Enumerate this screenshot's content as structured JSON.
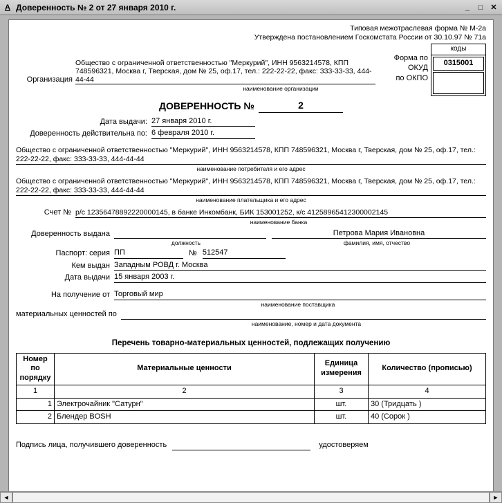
{
  "window": {
    "title": "Доверенность № 2 от 27 января 2010 г."
  },
  "hdr": {
    "form_line": "Типовая межотраслевая форма № М-2а",
    "approved_line": "Утверждена постановлением Госкомстата России от 30.10.97 № 71а",
    "okud_label": "Форма по ОКУД",
    "codes_label": "коды",
    "okud_code": "0315001",
    "okpo_label": "по ОКПО",
    "okpo_code": "",
    "org_label": "Организация",
    "org_text": "Общество с ограниченной ответственностью \"Меркурий\", ИНН 9563214578, КПП 748596321, Москва г, Тверская, дом № 25, оф.17, тел.: 222-22-22, факс: 333-33-33, 444-44-44",
    "org_caption": "наименование организации"
  },
  "doc": {
    "title": "ДОВЕРЕННОСТЬ  №",
    "number": "2",
    "issue_label": "Дата выдачи:",
    "issue_date": "27 января 2010 г.",
    "valid_label": "Доверенность действительна по:",
    "valid_date": "6 февраля 2010 г."
  },
  "consumer": {
    "text": "Общество с ограниченной ответственностью \"Меркурий\", ИНН 9563214578, КПП 748596321, Москва г, Тверская, дом № 25, оф.17, тел.: 222-22-22, факс: 333-33-33, 444-44-44",
    "caption": "наименование потребителя и его адрес"
  },
  "payer": {
    "text": "Общество с ограниченной ответственностью \"Меркурий\", ИНН 9563214578, КПП 748596321, Москва г, Тверская, дом № 25, оф.17, тел.: 222-22-22, факс: 333-33-33, 444-44-44",
    "caption": "наименование плательщика и его адрес"
  },
  "bank": {
    "account_label": "Счет №",
    "account_text": "р/с 12356478892220000145, в банке Инкомбанк, БИК 153001252, к/с 41258965412300002145",
    "caption": "наименование банка"
  },
  "person": {
    "issued_label": "Доверенность выдана",
    "position": "",
    "position_caption": "должность",
    "fio": "Петрова Мария Ивановна",
    "fio_caption": "фамилия, имя, отчество",
    "pass_label": "Паспорт: серия",
    "pass_series": "ПП",
    "pass_num_label": "№",
    "pass_num": "512547",
    "issued_by_label": "Кем выдан",
    "issued_by": "Западным РОВД г. Москва",
    "issue_date_label": "Дата выдачи",
    "issue_date": "15 января 2003 г."
  },
  "receive": {
    "from_label": "На получение от",
    "supplier": "Торговый мир",
    "supplier_caption": "наименование поставщика",
    "values_label": "материальных ценностей по",
    "doc_caption": "наименование, номер и дата документа"
  },
  "items_section": {
    "title": "Перечень товарно-материальных ценностей, подлежащих получению",
    "col1": "Номер по порядку",
    "col2": "Материальные ценности",
    "col3": "Единица измерения",
    "col4": "Количество (прописью)",
    "h1": "1",
    "h2": "2",
    "h3": "3",
    "h4": "4"
  },
  "items": [
    {
      "n": "1",
      "name": "Электрочайник \"Сатурн\"",
      "unit": "шт.",
      "qty": "30 (Тридцать )"
    },
    {
      "n": "2",
      "name": "Блендер BOSH",
      "unit": "шт.",
      "qty": "40 (Сорок )"
    }
  ],
  "footer": {
    "sig_label": "Подпись лица, получившего доверенность",
    "confirm": "удостоверяем"
  }
}
